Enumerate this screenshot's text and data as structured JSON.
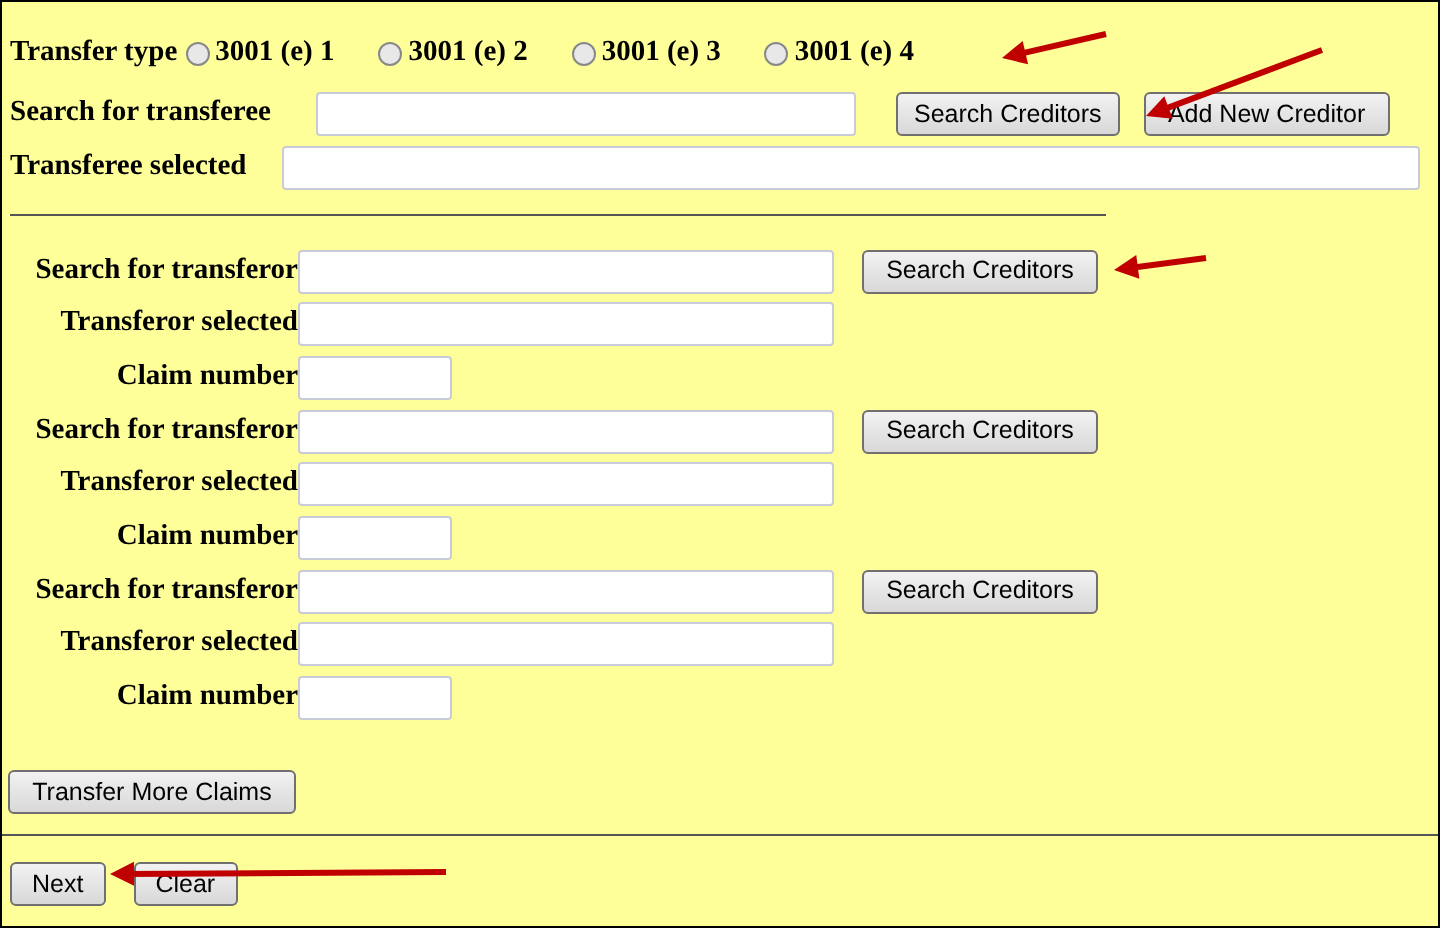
{
  "transfer_type": {
    "label": "Transfer type",
    "options": [
      {
        "label": "3001 (e) 1",
        "selected": false
      },
      {
        "label": "3001 (e) 2",
        "selected": false
      },
      {
        "label": "3001 (e) 3",
        "selected": false
      },
      {
        "label": "3001 (e) 4",
        "selected": false
      }
    ]
  },
  "transferee": {
    "search_label": "Search for transferee",
    "search_button": "Search Creditors",
    "add_button": "Add New Creditor",
    "selected_label": "Transferee selected"
  },
  "transferors": [
    {
      "search_label": "Search for transferor",
      "search_button": "Search Creditors",
      "selected_label": "Transferor selected",
      "claim_label": "Claim number"
    },
    {
      "search_label": "Search for transferor",
      "search_button": "Search Creditors",
      "selected_label": "Transferor selected",
      "claim_label": "Claim number"
    },
    {
      "search_label": "Search for transferor",
      "search_button": "Search Creditors",
      "selected_label": "Transferor selected",
      "claim_label": "Claim number"
    }
  ],
  "more_button": "Transfer More Claims",
  "actions": [
    "Next",
    "Clear"
  ]
}
